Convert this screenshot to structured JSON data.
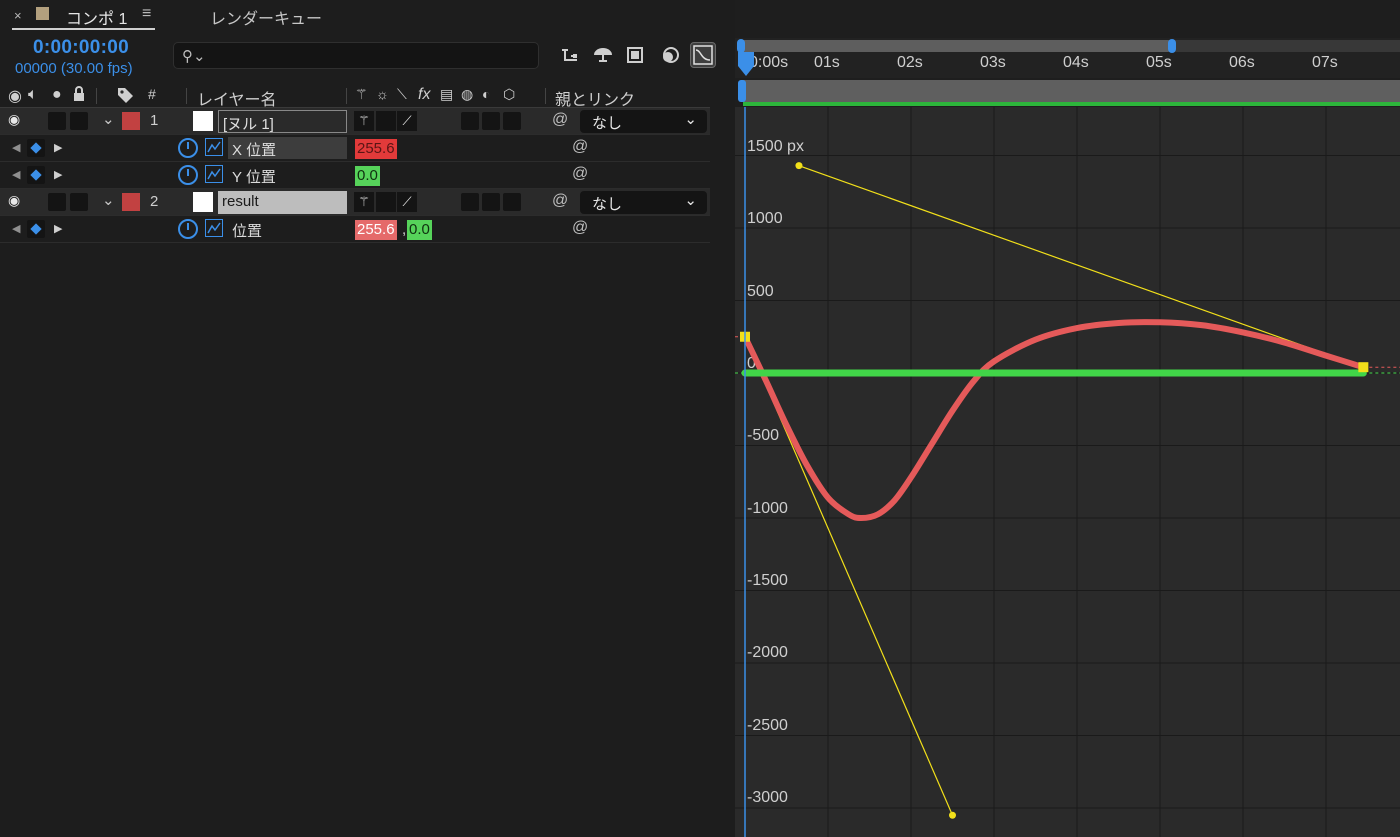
{
  "tabs": {
    "close": "×",
    "comp_label": "コンポ 1",
    "menu": "≡",
    "render_queue": "レンダーキュー"
  },
  "time": {
    "timecode": "0:00:00:00",
    "frames_fps": "00000 (30.00 fps)"
  },
  "search": {
    "icon": "⚲⌄",
    "value": ""
  },
  "column_headers": {
    "number": "#",
    "layer_name": "レイヤー名",
    "parent_link": "親とリンク",
    "fx": "fx"
  },
  "layers": [
    {
      "number": "1",
      "name": "[ヌル 1]",
      "parent": "なし",
      "properties": [
        {
          "name": "X 位置",
          "value": "255.6"
        },
        {
          "name": "Y 位置",
          "value": "0.0"
        }
      ]
    },
    {
      "number": "2",
      "name": "result",
      "parent": "なし",
      "properties": [
        {
          "name": "位置",
          "value_x": "255.6",
          "value_sep": ",",
          "value_y": "0.0"
        }
      ]
    }
  ],
  "ruler": {
    "labels": [
      "0:00s",
      "01s",
      "02s",
      "03s",
      "04s",
      "05s",
      "06s",
      "07s"
    ]
  },
  "graph": {
    "y_labels": [
      "1500 px",
      "1000",
      "500",
      "0",
      "-500",
      "-1000",
      "-1500",
      "-2000",
      "-2500",
      "-3000"
    ]
  },
  "chart_data": {
    "type": "line",
    "xlabel": "",
    "ylabel": "",
    "xlim": [
      0,
      8
    ],
    "ylim": [
      -3150,
      1650
    ],
    "grid": true,
    "series": [
      {
        "color": "#e55a5a",
        "x": [
          0,
          0.25,
          0.5,
          0.75,
          1.0,
          1.25,
          1.4,
          1.6,
          1.8,
          2.0,
          2.25,
          2.5,
          2.75,
          3.0,
          3.5,
          4.0,
          4.5,
          5.0,
          5.5,
          6.0,
          6.5,
          7.0,
          7.45
        ],
        "y": [
          250,
          -50,
          -360,
          -640,
          -860,
          -975,
          -1000,
          -975,
          -880,
          -720,
          -490,
          -260,
          -60,
          80,
          230,
          310,
          345,
          350,
          330,
          280,
          210,
          120,
          40
        ]
      },
      {
        "color": "#41d548",
        "x": [
          0,
          7.45
        ],
        "y": [
          0,
          0
        ]
      }
    ],
    "keyframes": [
      {
        "x": 0,
        "y": 250
      },
      {
        "x": 7.45,
        "y": 40
      }
    ],
    "bezier_handles": [
      {
        "from": {
          "x": 0,
          "y": 250
        },
        "to": {
          "x": 2.5,
          "y": -3050
        }
      },
      {
        "from": {
          "x": 7.45,
          "y": 40
        },
        "to": {
          "x": 0.65,
          "y": 1430
        }
      }
    ]
  },
  "colors": {
    "accent": "#3b8fe8",
    "layer_label": "#c24141",
    "value_x": "#e23a3a",
    "value_y": "#56d35a",
    "curve_x": "#e55a5a",
    "curve_y": "#41d548",
    "handle": "#f2e01a"
  }
}
